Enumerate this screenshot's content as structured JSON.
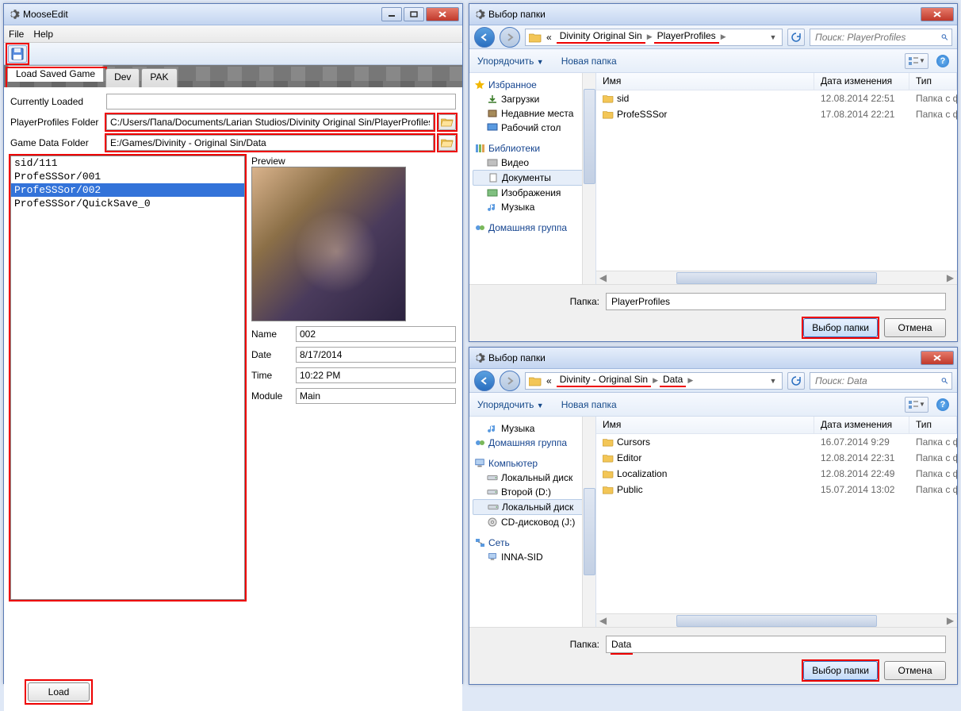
{
  "mooseedit": {
    "title": "MooseEdit",
    "menu": {
      "file": "File",
      "help": "Help"
    },
    "tabs": {
      "load": "Load Saved Game",
      "dev": "Dev",
      "pak": "PAK"
    },
    "currently_loaded_label": "Currently Loaded",
    "currently_loaded_value": "",
    "player_profiles_label": "PlayerProfiles Folder",
    "player_profiles_value": "C:/Users/Папа/Documents/Larian Studios/Divinity Original Sin/PlayerProfiles",
    "game_data_label": "Game Data Folder",
    "game_data_value": "E:/Games/Divinity - Original Sin/Data",
    "saves": [
      "sid/111",
      "ProfeSSSor/001",
      "ProfeSSSor/002",
      "ProfeSSSor/QuickSave_0"
    ],
    "preview_label": "Preview",
    "details": {
      "name_label": "Name",
      "name_value": "002",
      "date_label": "Date",
      "date_value": "8/17/2014",
      "time_label": "Time",
      "time_value": "10:22 PM",
      "module_label": "Module",
      "module_value": "Main"
    },
    "load_btn": "Load"
  },
  "dlg1": {
    "title": "Выбор папки",
    "crumbs": {
      "pre": "«",
      "c1": "Divinity Original Sin",
      "c2": "PlayerProfiles"
    },
    "search_placeholder": "Поиск: PlayerProfiles",
    "toolbar": {
      "org": "Упорядочить",
      "newf": "Новая папка"
    },
    "tree": {
      "fav": "Избранное",
      "downloads": "Загрузки",
      "recent": "Недавние места",
      "desktop": "Рабочий стол",
      "libs": "Библиотеки",
      "video": "Видео",
      "docs": "Документы",
      "images": "Изображения",
      "music": "Музыка",
      "homegroup": "Домашняя группа"
    },
    "cols": {
      "name": "Имя",
      "date": "Дата изменения",
      "type": "Тип"
    },
    "rows": [
      {
        "name": "sid",
        "date": "12.08.2014 22:51",
        "type": "Папка с ф"
      },
      {
        "name": "ProfeSSSor",
        "date": "17.08.2014 22:21",
        "type": "Папка с ф"
      }
    ],
    "folder_label": "Папка:",
    "folder_value": "PlayerProfiles",
    "select_btn": "Выбор папки",
    "cancel_btn": "Отмена"
  },
  "dlg2": {
    "title": "Выбор папки",
    "crumbs": {
      "pre": "«",
      "c1": "Divinity - Original Sin",
      "c2": "Data"
    },
    "search_placeholder": "Поиск: Data",
    "toolbar": {
      "org": "Упорядочить",
      "newf": "Новая папка"
    },
    "tree": {
      "music": "Музыка",
      "homegroup": "Домашняя группа",
      "computer": "Компьютер",
      "local_c": "Локальный диск",
      "second_d": "Второй (D:)",
      "local_e": "Локальный диск",
      "cd": "CD-дисковод (J:)",
      "network": "Сеть",
      "inna": "INNA-SID"
    },
    "cols": {
      "name": "Имя",
      "date": "Дата изменения",
      "type": "Тип"
    },
    "rows": [
      {
        "name": "Cursors",
        "date": "16.07.2014 9:29",
        "type": "Папка с ф"
      },
      {
        "name": "Editor",
        "date": "12.08.2014 22:31",
        "type": "Папка с ф"
      },
      {
        "name": "Localization",
        "date": "12.08.2014 22:49",
        "type": "Папка с ф"
      },
      {
        "name": "Public",
        "date": "15.07.2014 13:02",
        "type": "Папка с ф"
      }
    ],
    "folder_label": "Папка:",
    "folder_value": "Data",
    "select_btn": "Выбор папки",
    "cancel_btn": "Отмена"
  }
}
